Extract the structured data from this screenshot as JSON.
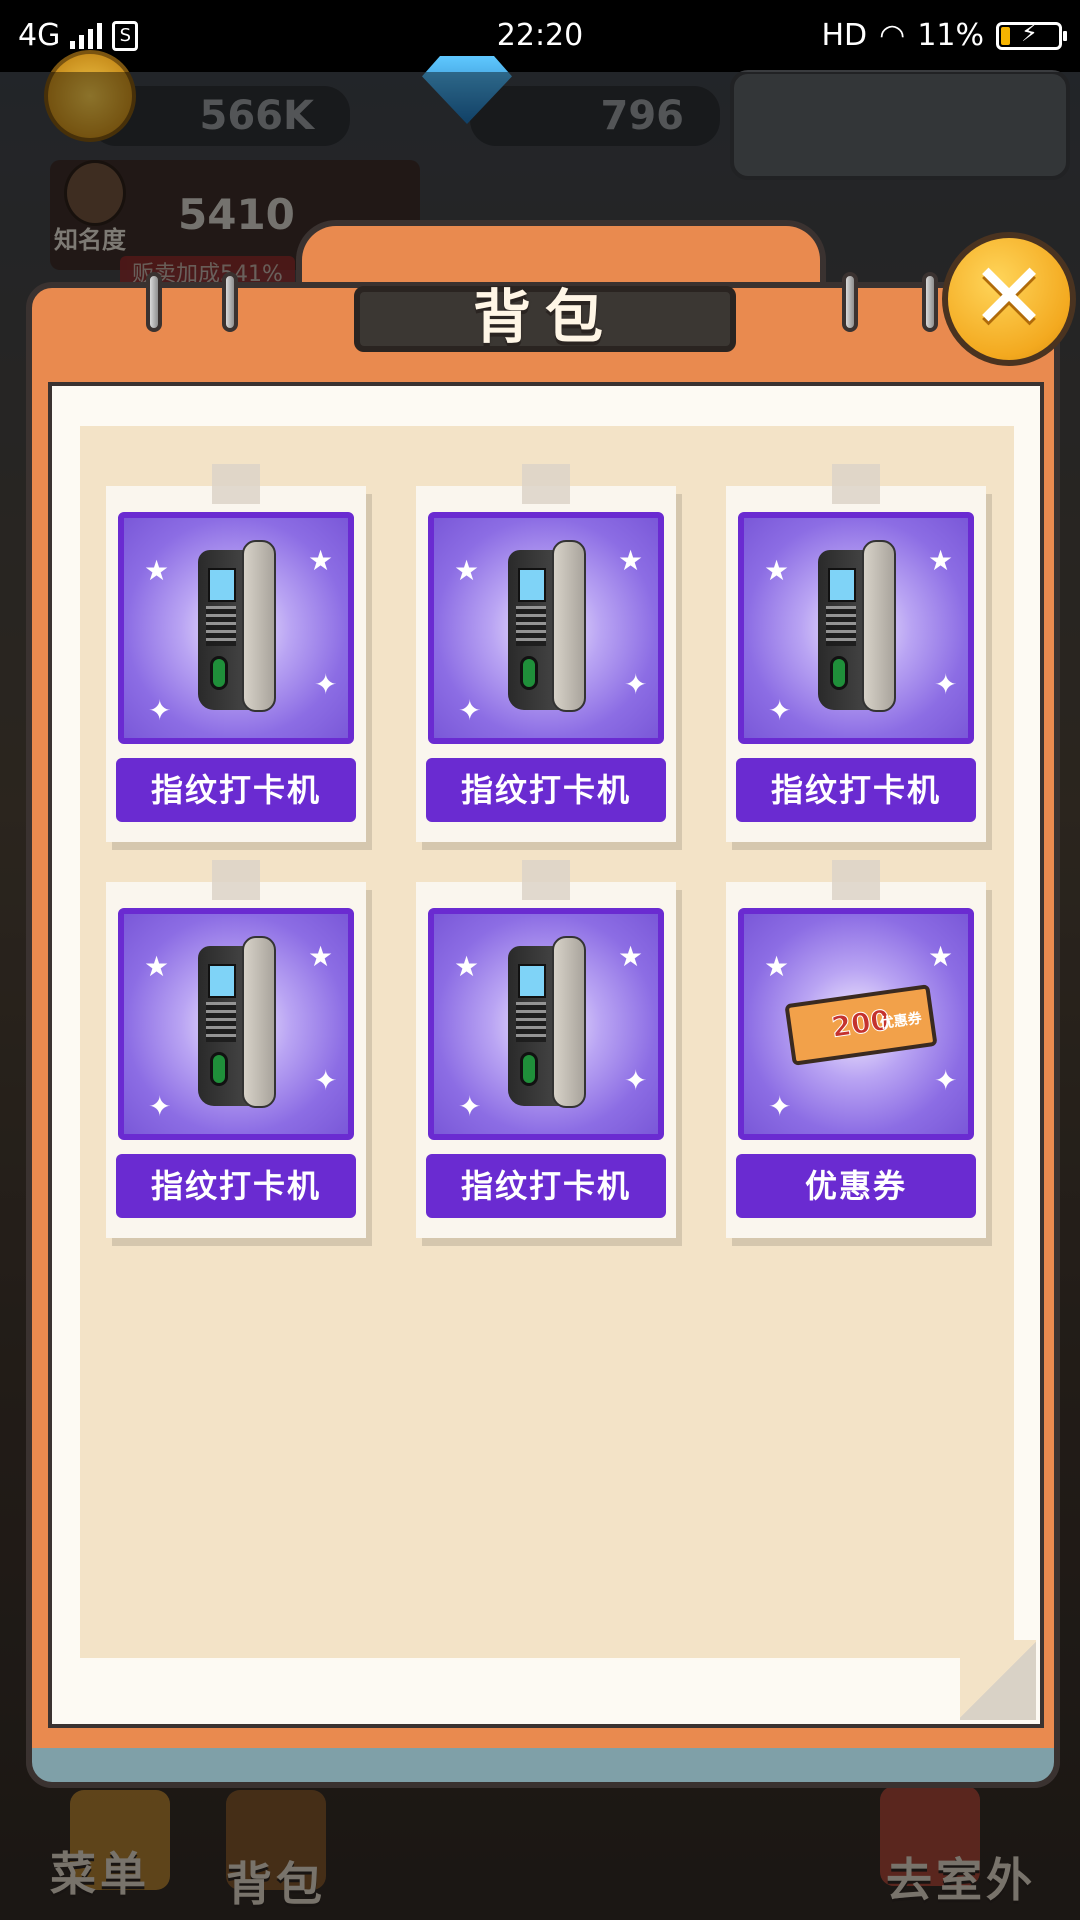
{
  "status_bar": {
    "network": "4G",
    "time": "22:20",
    "hd": "HD",
    "battery": "11%",
    "battery_level": 0.11
  },
  "hud": {
    "coins": "566K",
    "gems": "796",
    "fame_label": "知名度",
    "fame_value": "5410",
    "fame_sub": "贩卖加成541%"
  },
  "bottom_nav": {
    "menu": "菜单",
    "bag": "背包",
    "outside": "去室外"
  },
  "panel": {
    "title": "背包",
    "close": "✕"
  },
  "items": [
    {
      "label": "指纹打卡机",
      "icon": "fingerprint-clock-icon"
    },
    {
      "label": "指纹打卡机",
      "icon": "fingerprint-clock-icon"
    },
    {
      "label": "指纹打卡机",
      "icon": "fingerprint-clock-icon"
    },
    {
      "label": "指纹打卡机",
      "icon": "fingerprint-clock-icon"
    },
    {
      "label": "指纹打卡机",
      "icon": "fingerprint-clock-icon"
    },
    {
      "label": "优惠券",
      "icon": "coupon-icon",
      "coupon_amount": "200",
      "coupon_text": "优惠券"
    }
  ],
  "colors": {
    "panel_orange": "#e98a4f",
    "item_purple": "#6a2bd1",
    "close_gold": "#f3a91f",
    "paper": "#f3e3c7"
  }
}
